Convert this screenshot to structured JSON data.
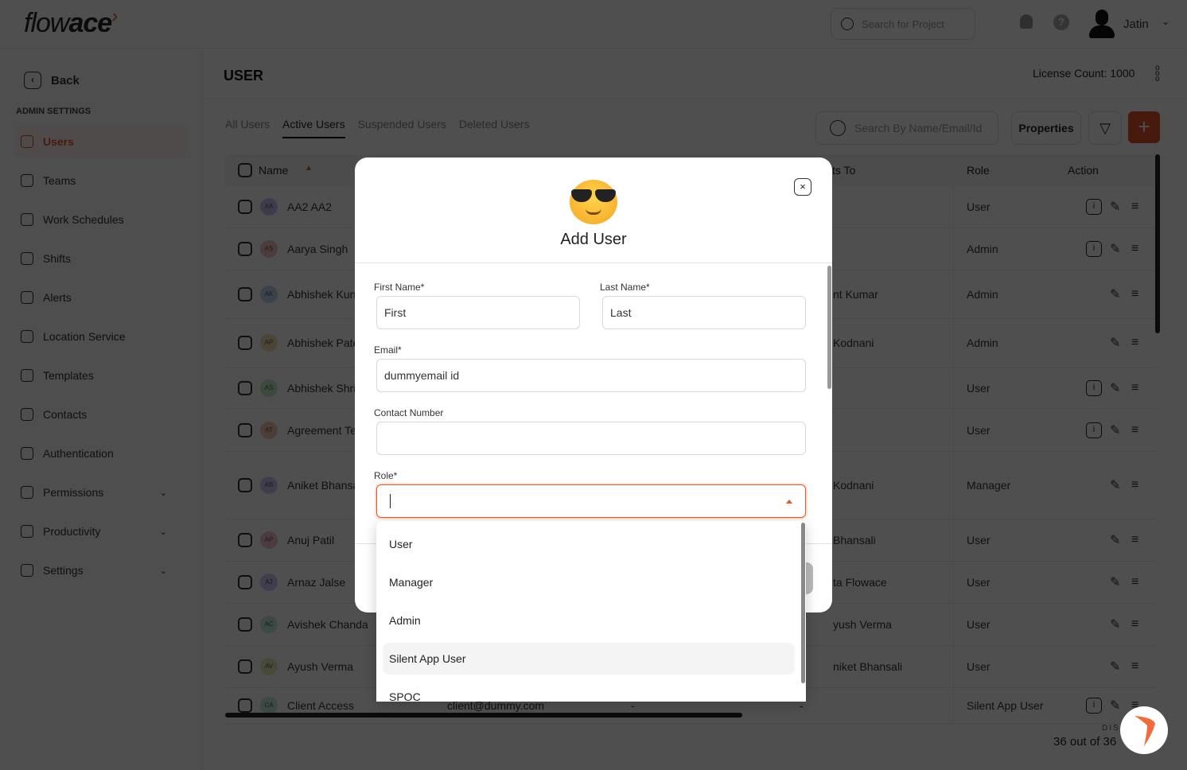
{
  "header": {
    "logo": "flowace",
    "project_search_placeholder": "Search for Project",
    "user_name": "Jatin"
  },
  "sidebar": {
    "back": "Back",
    "section": "ADMIN SETTINGS",
    "items": [
      {
        "label": "Users",
        "active": true
      },
      {
        "label": "Teams"
      },
      {
        "label": "Work Schedules"
      },
      {
        "label": "Shifts"
      },
      {
        "label": "Alerts"
      },
      {
        "label": "Location Service"
      },
      {
        "label": "Templates"
      },
      {
        "label": "Contacts"
      },
      {
        "label": "Authentication"
      },
      {
        "label": "Permissions",
        "expandable": true
      },
      {
        "label": "Productivity",
        "expandable": true
      },
      {
        "label": "Settings",
        "expandable": true
      }
    ]
  },
  "main": {
    "title": "USER",
    "license": "License Count: 1000",
    "tabs": [
      {
        "label": "All Users"
      },
      {
        "label": "Active Users",
        "active": true
      },
      {
        "label": "Suspended Users"
      },
      {
        "label": "Deleted Users"
      }
    ],
    "search_placeholder": "Search By Name/Email/Id",
    "properties": "Properties",
    "add": "+",
    "columns": {
      "name": "Name",
      "reports_to": "ts To",
      "role": "Role",
      "action": "Action"
    },
    "rows": [
      {
        "initials": "AA",
        "name": "AA2 AA2",
        "reports": "",
        "role": "User",
        "info": true,
        "color": "#c9c0f0"
      },
      {
        "initials": "AS",
        "name": "Aarya Singh",
        "reports": "",
        "role": "Admin",
        "info": true,
        "color": "#f5c0c0"
      },
      {
        "initials": "AK",
        "name": "Abhishek Kun",
        "reports": "nt Kumar",
        "role": "Admin",
        "info": false,
        "color": "#c0d4f5"
      },
      {
        "initials": "AP",
        "name": "Abhishek Pate",
        "reports": "Kodnani",
        "role": "Admin",
        "info": false,
        "color": "#f5e0b0"
      },
      {
        "initials": "AS",
        "name": "Abhishek Shri",
        "reports": "",
        "role": "User",
        "info": true,
        "color": "#c0f0c8"
      },
      {
        "initials": "AT",
        "name": "Agreement Te",
        "reports": "",
        "role": "User",
        "info": true,
        "color": "#f5c8b0"
      },
      {
        "initials": "AB",
        "name": "Aniket Bhansa",
        "reports": "Kodnani",
        "role": "Manager",
        "info": false,
        "color": "#d0c8f5"
      },
      {
        "initials": "AP",
        "name": "Anuj Patil",
        "reports": "Bhansali",
        "role": "User",
        "info": false,
        "color": "#f5c0d0"
      },
      {
        "initials": "AJ",
        "name": "Arnaz Jalse",
        "reports": "ta Flowace",
        "role": "User",
        "info": false,
        "color": "#d0c8f5"
      },
      {
        "initials": "AC",
        "name": "Avishek Chanda",
        "reports": "yush Verma",
        "role": "User",
        "info": false,
        "color": "#c0f0e0"
      },
      {
        "initials": "AV",
        "name": "Ayush Verma",
        "reports": "niket Bhansali",
        "role": "User",
        "info": false,
        "color": "#e8f0b0"
      },
      {
        "initials": "CA",
        "name": "Client Access",
        "email": "client@dummy.com",
        "col3": "-",
        "reports": "-",
        "role": "Silent App User",
        "info": true,
        "color": "#c0f0e0"
      }
    ],
    "display_label": "DIS",
    "count": "36 out of 36"
  },
  "modal": {
    "title": "Add User",
    "first_name": {
      "label": "First Name*",
      "value": "First"
    },
    "last_name": {
      "label": "Last Name*",
      "value": "Last"
    },
    "email": {
      "label": "Email*",
      "value": "dummyemail id"
    },
    "contact": {
      "label": "Contact Number",
      "value": ""
    },
    "role": {
      "label": "Role*",
      "value": ""
    },
    "role_options": [
      {
        "label": "User"
      },
      {
        "label": "Manager"
      },
      {
        "label": "Admin"
      },
      {
        "label": "Silent App User",
        "highlighted": true
      },
      {
        "label": "SPOC"
      }
    ]
  },
  "colors": {
    "accent": "#e8552a"
  }
}
